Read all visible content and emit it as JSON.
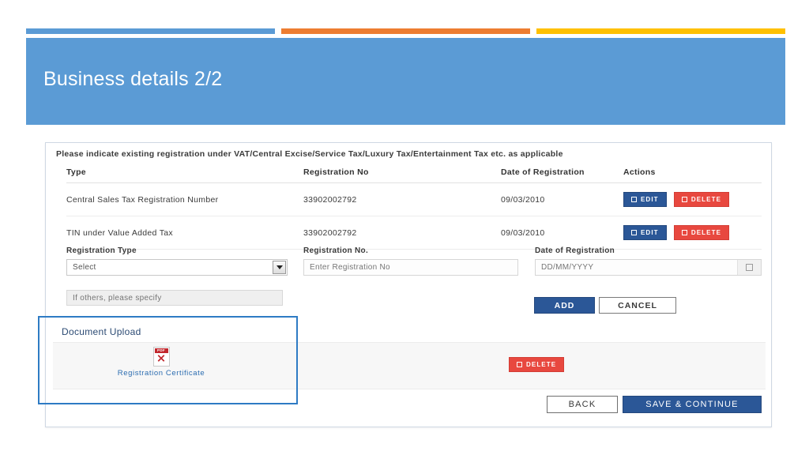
{
  "accents": {
    "blue": "#5B9BD5",
    "orange": "#ED7D31",
    "yellow": "#FFC000"
  },
  "header": {
    "title": "Business details 2/2"
  },
  "card": {
    "instruction": "Please indicate existing registration under VAT/Central Excise/Service Tax/Luxury Tax/Entertainment Tax etc. as applicable",
    "table": {
      "columns": [
        "Type",
        "Registration No",
        "Date of Registration",
        "Actions"
      ],
      "rows": [
        {
          "type": "Central Sales Tax Registration Number",
          "registration_no": "33902002792",
          "date": "09/03/2010",
          "edit_label": "EDIT",
          "delete_label": "DELETE"
        },
        {
          "type": "TIN under Value Added Tax",
          "registration_no": "33902002792",
          "date": "09/03/2010",
          "edit_label": "EDIT",
          "delete_label": "DELETE"
        }
      ]
    },
    "form": {
      "registration_type": {
        "label": "Registration Type",
        "value": "Select"
      },
      "registration_no": {
        "label": "Registration No.",
        "placeholder": "Enter Registration No",
        "value": ""
      },
      "date_of_registration": {
        "label": "Date of Registration",
        "placeholder": "DD/MM/YYYY",
        "value": ""
      },
      "others": {
        "placeholder": "If others, please specify",
        "value": ""
      },
      "add_label": "ADD",
      "cancel_label": "CANCEL"
    },
    "document_upload": {
      "title": "Document Upload",
      "file_name": "Registration Certificate",
      "file_type_label": "PDF",
      "delete_label": "DELETE"
    },
    "footer": {
      "back_label": "BACK",
      "save_label": "SAVE & CONTINUE"
    }
  }
}
